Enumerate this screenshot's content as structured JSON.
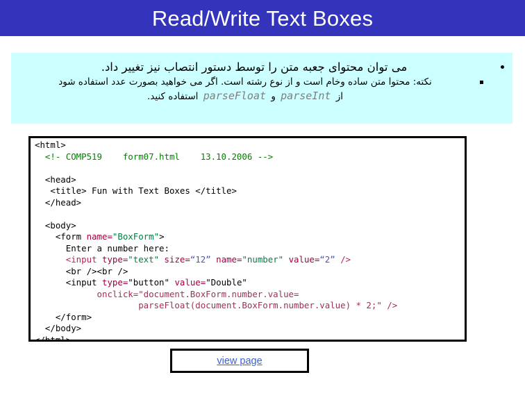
{
  "slide": {
    "title": "Read/Write Text Boxes",
    "banner_color": "#3333bb",
    "banner_text_color": "#ffffff"
  },
  "note_panel": {
    "background_color": "#ccffff",
    "bullet1": {
      "marker": "disc-bullet",
      "text": "می توان محتوای جعبه متن را توسط دستور انتصاب نیز تغییر داد."
    },
    "bullet2": {
      "marker": "square-bullet",
      "text": "نکته:  محتوا متن ساده وخام است و از نوع رشته است. اگر می خواهید بصورت عدد استفاده شود"
    },
    "bullet3": {
      "text_before": "از",
      "code1": "parseInt",
      "conjunction": "و",
      "code2": "parseFloat",
      "text_after": "استفاده کنید.",
      "code_color": "#7f7f7f"
    }
  },
  "code_box": {
    "border_color": "#000000",
    "lines": [
      [
        {
          "t": "<html>",
          "c": "plain"
        }
      ],
      [
        {
          "t": "  ",
          "c": "plain"
        },
        {
          "t": "<!- COMP519    form07.html    13.10.2006 -->",
          "c": "comment"
        }
      ],
      [
        {
          "t": "",
          "c": "plain"
        }
      ],
      [
        {
          "t": "  <head>",
          "c": "plain"
        }
      ],
      [
        {
          "t": "   <title> Fun with Text Boxes </title>",
          "c": "plain"
        }
      ],
      [
        {
          "t": "  </head>",
          "c": "plain"
        }
      ],
      [
        {
          "t": "",
          "c": "plain"
        }
      ],
      [
        {
          "t": "  <body>",
          "c": "plain"
        }
      ],
      [
        {
          "t": "    <form ",
          "c": "plain"
        },
        {
          "t": "name=",
          "c": "attr"
        },
        {
          "t": "\"BoxForm\"",
          "c": "str"
        },
        {
          "t": ">",
          "c": "plain"
        }
      ],
      [
        {
          "t": "      Enter a number here:",
          "c": "plain"
        }
      ],
      [
        {
          "t": "      ",
          "c": "plain"
        },
        {
          "t": "<input ",
          "c": "tag"
        },
        {
          "t": "type=",
          "c": "attr"
        },
        {
          "t": "\"text\"",
          "c": "str"
        },
        {
          "t": " size=",
          "c": "attr"
        },
        {
          "t": "“12”",
          "c": "num"
        },
        {
          "t": " name=",
          "c": "attr"
        },
        {
          "t": "\"number\"",
          "c": "str"
        },
        {
          "t": " value=",
          "c": "attr"
        },
        {
          "t": "“2”",
          "c": "num"
        },
        {
          "t": " />",
          "c": "tag"
        }
      ],
      [
        {
          "t": "      <br /><br />",
          "c": "plain"
        }
      ],
      [
        {
          "t": "      <input ",
          "c": "plain"
        },
        {
          "t": "type=",
          "c": "attr"
        },
        {
          "t": "\"button\"",
          "c": "plain"
        },
        {
          "t": " value=",
          "c": "attr"
        },
        {
          "t": "\"Double\"",
          "c": "plain"
        }
      ],
      [
        {
          "t": "            ",
          "c": "plain"
        },
        {
          "t": "onclick=\"document.BoxForm.number.value=",
          "c": "js"
        }
      ],
      [
        {
          "t": "                    ",
          "c": "plain"
        },
        {
          "t": "parseFloat(document.BoxForm.number.value) * 2;\" />",
          "c": "js"
        }
      ],
      [
        {
          "t": "    </form>",
          "c": "plain"
        }
      ],
      [
        {
          "t": "  </body>",
          "c": "plain"
        }
      ],
      [
        {
          "t": "</html>",
          "c": "plain"
        }
      ]
    ]
  },
  "view_page": {
    "label": "view page",
    "link_color": "#3c5fdd"
  }
}
